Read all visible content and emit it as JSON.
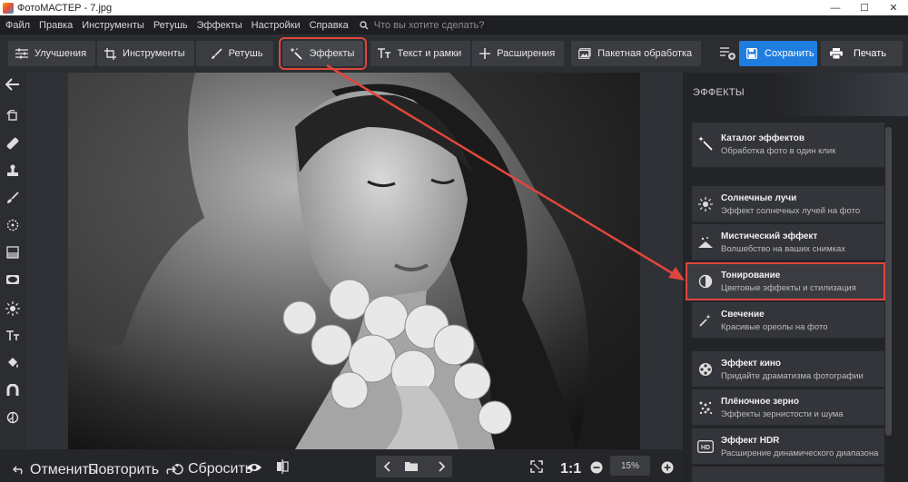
{
  "window": {
    "title": "ФотоМАСТЕР - 7.jpg",
    "minimize": "—",
    "maximize": "☐",
    "close": "✕"
  },
  "menu": {
    "items": [
      "Файл",
      "Правка",
      "Инструменты",
      "Ретушь",
      "Эффекты",
      "Настройки",
      "Справка"
    ],
    "search_placeholder": "Что вы хотите сделать?"
  },
  "toolbar": {
    "improve": "Улучшения",
    "tools": "Инструменты",
    "retouch": "Ретушь",
    "effects": "Эффекты",
    "text": "Текст и рамки",
    "extensions": "Расширения",
    "batch": "Пакетная обработка",
    "save": "Сохранить",
    "print": "Печать"
  },
  "panel": {
    "title": "ЭФФЕКТЫ",
    "catalog": {
      "name": "Каталог эффектов",
      "desc": "Обработка фото в один клик"
    },
    "items": [
      {
        "name": "Солнечные лучи",
        "desc": "Эффект солнечных лучей на фото",
        "icon": "sun-icon"
      },
      {
        "name": "Мистический эффект",
        "desc": "Волшебство на ваших снимках",
        "icon": "mystic-icon"
      },
      {
        "name": "Тонирование",
        "desc": "Цветовые эффекты и стилизация",
        "icon": "toning-icon"
      },
      {
        "name": "Свечение",
        "desc": "Красивые ореолы на фото",
        "icon": "glow-icon"
      },
      {
        "name": "Эффект кино",
        "desc": "Придайте драматизма фотографии",
        "icon": "film-reel-icon"
      },
      {
        "name": "Плёночное зерно",
        "desc": "Эффекты зернистости и шума",
        "icon": "grain-icon"
      },
      {
        "name": "Эффект HDR",
        "desc": "Расширение динамического диапазона",
        "icon": "hdr-icon"
      }
    ]
  },
  "bottom": {
    "undo": "Отменить",
    "redo": "Повторить",
    "reset": "Сбросить",
    "ratio": "1:1",
    "zoom": "15%"
  },
  "colors": {
    "accent": "#1f7de0",
    "highlight": "#e0463c",
    "bg": "#2b2d31"
  }
}
